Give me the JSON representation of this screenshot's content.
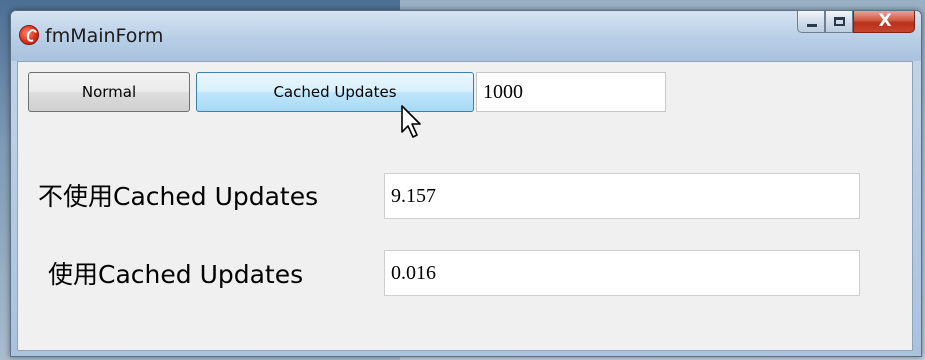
{
  "window": {
    "title": "fmMainForm",
    "close_symbol": "X",
    "background_window_title": "fmMainForm"
  },
  "toolbar": {
    "normal_label": "Normal",
    "cached_label": "Cached Updates",
    "count_value": "1000"
  },
  "results": {
    "without_label": "不使用Cached Updates",
    "without_value": "9.157",
    "with_label": "使用Cached Updates",
    "with_value": "0.016"
  },
  "icons": {
    "app": "app-icon",
    "minimize": "minimize-icon",
    "maximize": "maximize-icon",
    "close": "close-icon",
    "pointer": "mouse-pointer-icon"
  },
  "colors": {
    "titlebar": "#b7cde5",
    "close_button": "#c9442c",
    "hover_button": "#bee6fd",
    "client_background": "#f0f0f0"
  }
}
